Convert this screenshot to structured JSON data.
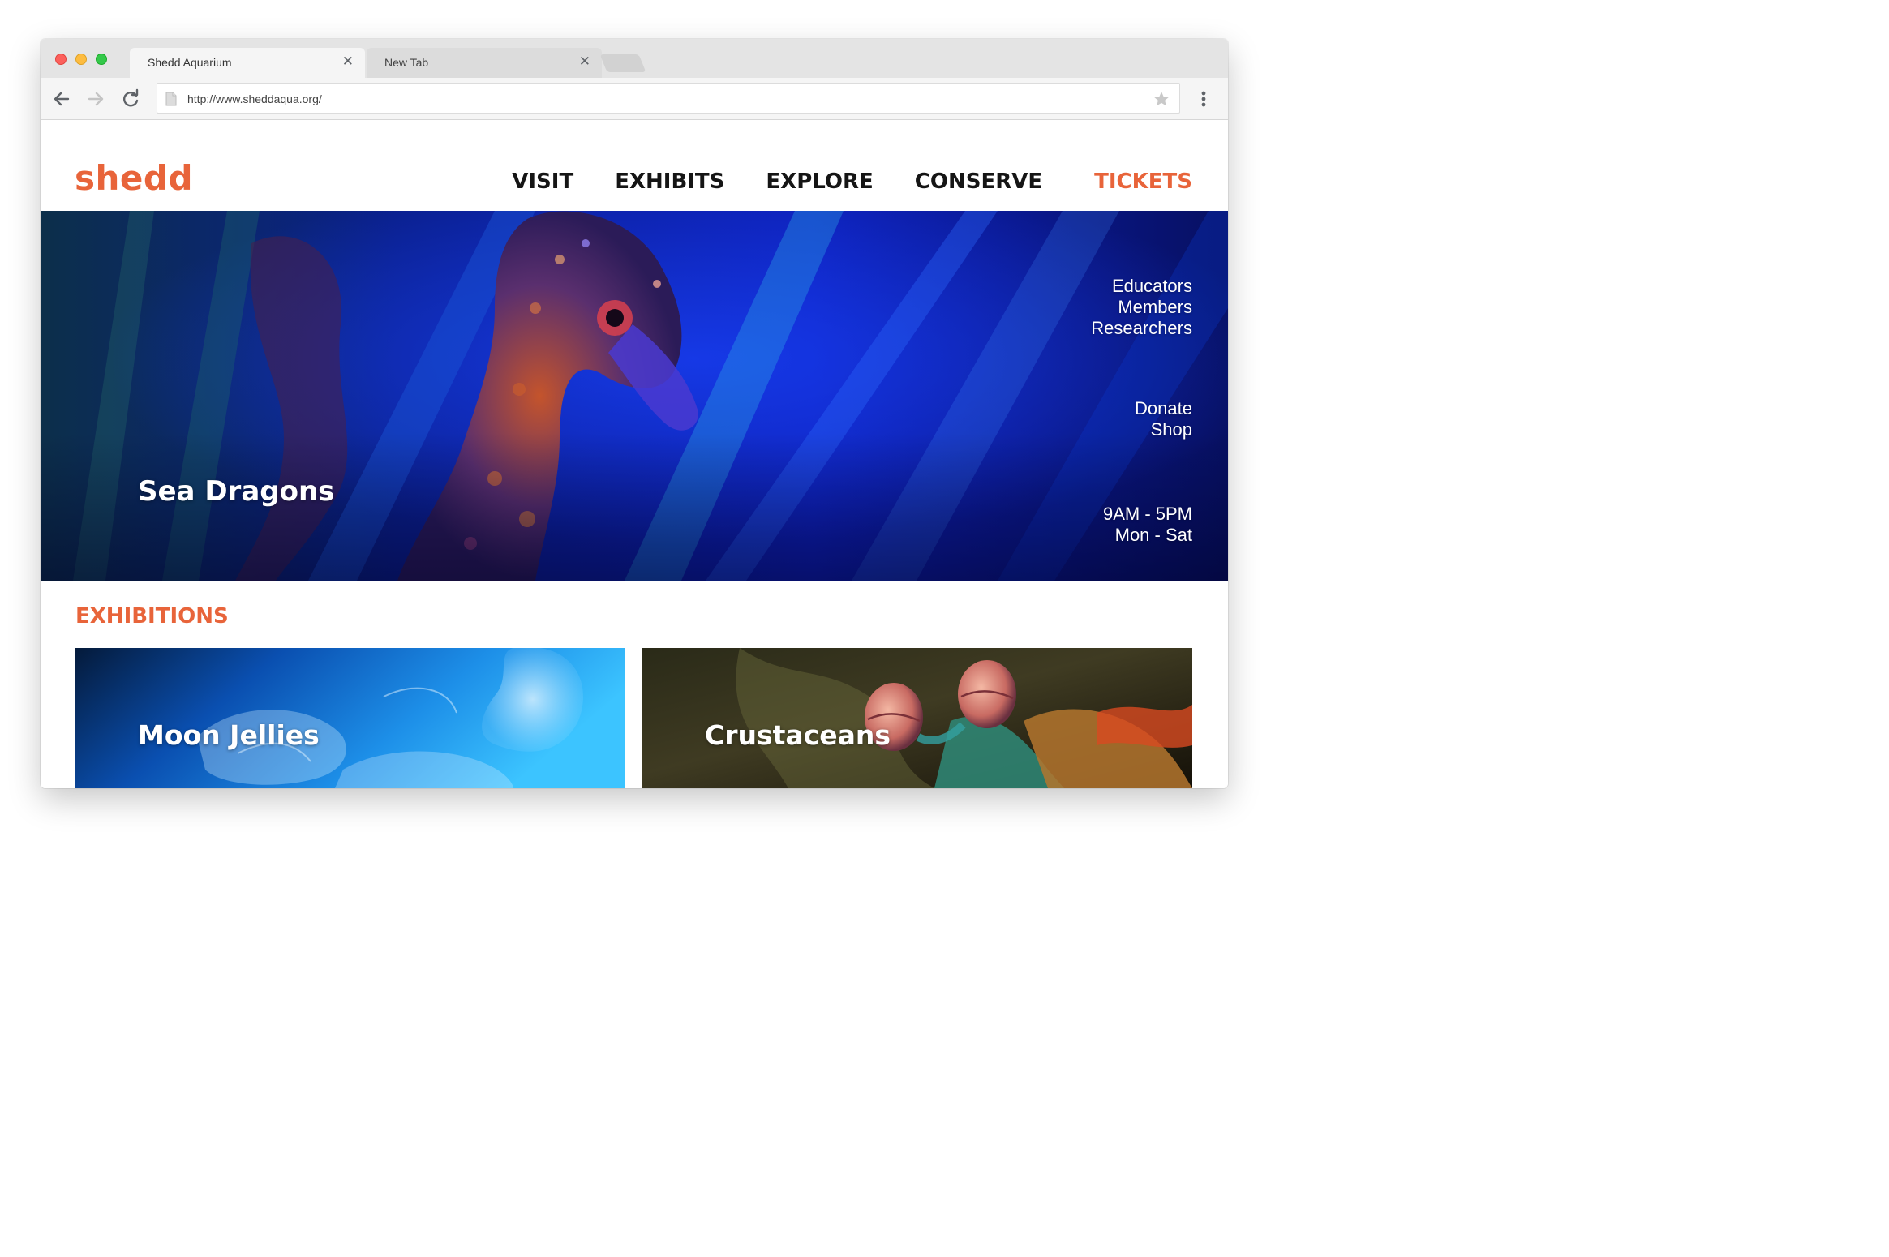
{
  "browser": {
    "tabs": [
      {
        "title": "Shedd Aquarium",
        "active": true,
        "close_glyph": "✕"
      },
      {
        "title": "New Tab",
        "active": false,
        "close_glyph": "✕"
      }
    ],
    "url": "http://www.sheddaqua.org/",
    "icons": {
      "back": "arrow-left-icon",
      "forward": "arrow-right-icon",
      "reload": "reload-icon",
      "page": "document-icon",
      "bookmark": "star-icon",
      "menu": "vertical-dots-icon"
    }
  },
  "site": {
    "logo": "shedd",
    "nav": {
      "visit": "VISIT",
      "exhibits": "EXHIBITS",
      "explore": "EXPLORE",
      "conserve": "CONSERVE",
      "tickets": "TICKETS"
    },
    "hero": {
      "title": "Sea Dragons",
      "audience_links": [
        "Educators",
        "Members",
        "Researchers"
      ],
      "action_links": [
        "Donate",
        "Shop"
      ],
      "hours": [
        "9AM - 5PM",
        "Mon - Sat"
      ]
    },
    "exhibitions": {
      "heading": "EXHIBITIONS",
      "cards": [
        {
          "title": "Moon Jellies"
        },
        {
          "title": "Crustaceans"
        }
      ]
    }
  },
  "colors": {
    "brand_orange": "#e8643a",
    "nav_text": "#151515",
    "hero_blue": "#0a1aa8",
    "chrome_gray": "#e4e4e4"
  }
}
